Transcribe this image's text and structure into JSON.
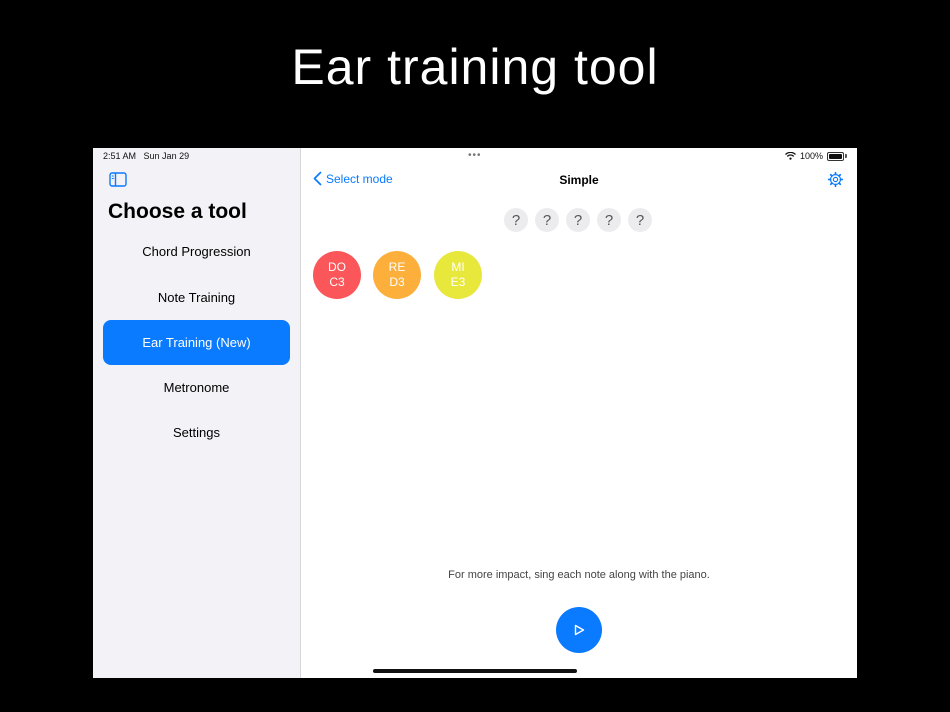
{
  "headline": "Ear training tool",
  "status_bar": {
    "time": "2:51 AM",
    "date": "Sun Jan 29",
    "battery": "100%",
    "dots": "•••"
  },
  "sidebar": {
    "title": "Choose a tool",
    "items": [
      {
        "label": "Chord Progression",
        "selected": false
      },
      {
        "label": "Note Training",
        "selected": false
      },
      {
        "label": "Ear Training (New)",
        "selected": true
      },
      {
        "label": "Metronome",
        "selected": false
      },
      {
        "label": "Settings",
        "selected": false
      }
    ]
  },
  "nav": {
    "back_label": "Select mode",
    "title": "Simple"
  },
  "questions": [
    "?",
    "?",
    "?",
    "?",
    "?"
  ],
  "notes": [
    {
      "solfege": "DO",
      "pitch": "C3",
      "color": "#fb5659"
    },
    {
      "solfege": "RE",
      "pitch": "D3",
      "color": "#fdaf3c"
    },
    {
      "solfege": "MI",
      "pitch": "E3",
      "color": "#e8e73b"
    }
  ],
  "hint": "For more impact, sing each note along with the piano.",
  "colors": {
    "accent": "#0a7aff",
    "sidebar_bg": "#f2f2f7"
  },
  "icons": {
    "toggle": "sidebar-toggle-icon",
    "back": "chevron-left-icon",
    "settings": "gear-icon",
    "play": "play-icon"
  }
}
